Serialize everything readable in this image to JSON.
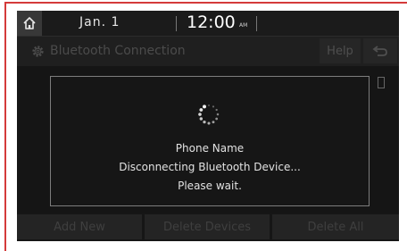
{
  "status": {
    "date": "Jan. 1",
    "time": "12:00",
    "ampm": "AM"
  },
  "header": {
    "title": "Bluetooth Connection",
    "help_label": "Help"
  },
  "dialog": {
    "device_name": "Phone Name",
    "status_text": "Disconnecting Bluetooth Device...",
    "wait_text": "Please wait."
  },
  "footer": {
    "add_new": "Add New",
    "delete_devices": "Delete Devices",
    "delete_all": "Delete All"
  },
  "colors": {
    "frame": "#d43a3a",
    "screen_bg": "#161616",
    "text": "#e2e2e2",
    "disabled_text": "#4b4b4b"
  },
  "icons": {
    "home": "home-icon",
    "settings": "gear-icon",
    "back": "back-arrow-icon",
    "loading": "loading-spinner-icon"
  }
}
